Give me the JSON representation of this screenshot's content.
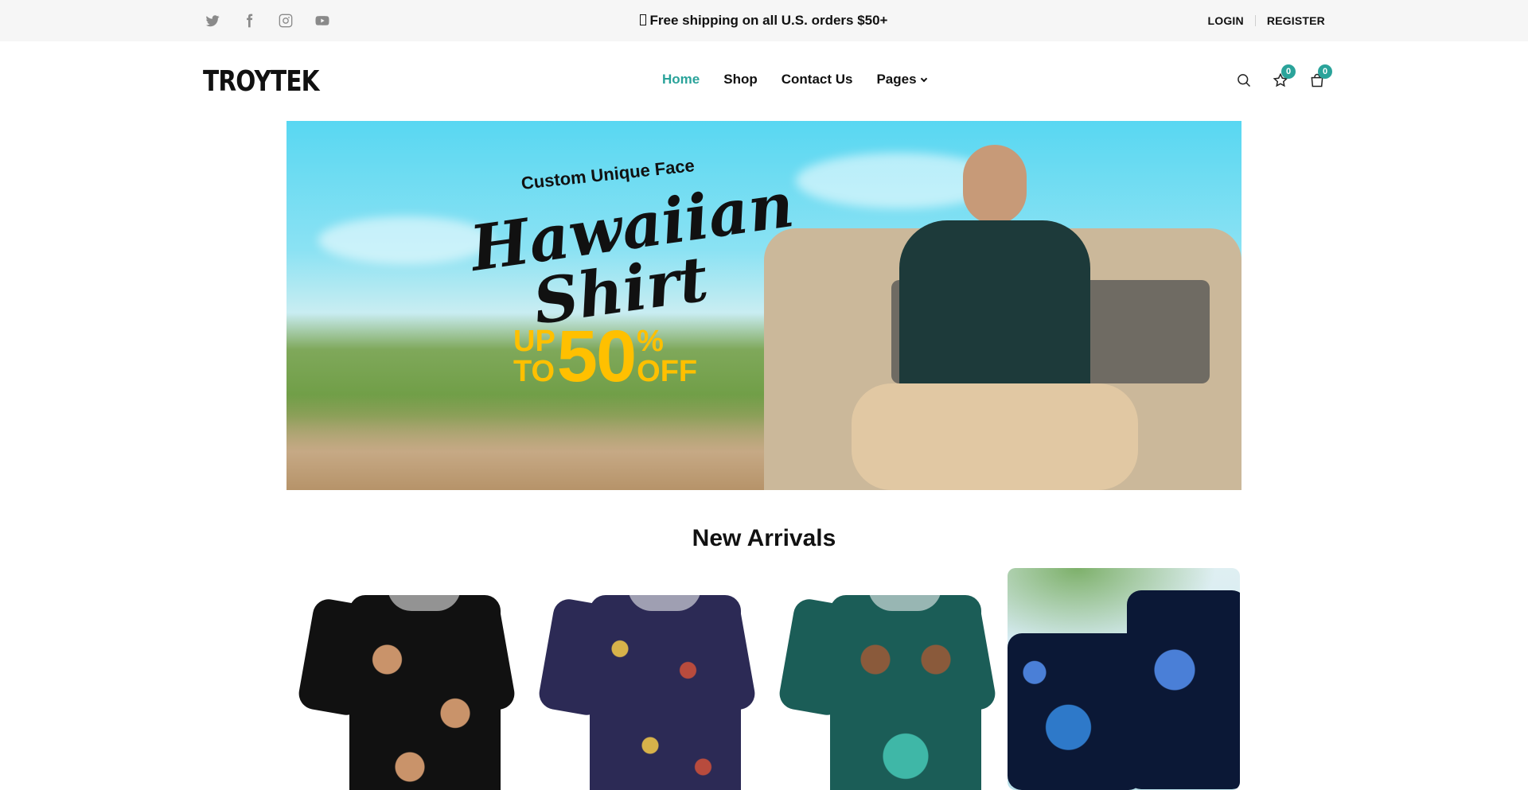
{
  "colors": {
    "accent": "#2aa39a",
    "topbar_bg": "#f6f6f6",
    "promo_yellow": "#ffc000"
  },
  "topbar": {
    "social": [
      {
        "name": "twitter-icon"
      },
      {
        "name": "facebook-icon"
      },
      {
        "name": "instagram-icon"
      },
      {
        "name": "youtube-icon"
      }
    ],
    "promo": "Free shipping on all U.S. orders $50+",
    "login": "LOGIN",
    "register": "REGISTER"
  },
  "header": {
    "logo": "TROYTEK",
    "nav": [
      {
        "label": "Home",
        "active": true
      },
      {
        "label": "Shop",
        "active": false
      },
      {
        "label": "Contact Us",
        "active": false
      },
      {
        "label": "Pages",
        "active": false,
        "has_dropdown": true
      }
    ],
    "wishlist_count": "0",
    "cart_count": "0"
  },
  "hero": {
    "line1": "Custom Unique Face",
    "line2": "Hawaiian",
    "line3": "Shirt",
    "up": "UP",
    "to": "TO",
    "percent_value": "50",
    "percent_sign": "%",
    "off": "OFF"
  },
  "new_arrivals": {
    "title": "New Arrivals",
    "products": [
      {
        "name": "product-card-1",
        "palette": [
          "#111111",
          "#c9936a"
        ]
      },
      {
        "name": "product-card-2",
        "palette": [
          "#2c2a55",
          "#c9813f"
        ]
      },
      {
        "name": "product-card-3",
        "palette": [
          "#1b5d57",
          "#3fb7a7"
        ]
      },
      {
        "name": "product-card-4",
        "palette": [
          "#0b1836",
          "#4a7fd7"
        ]
      }
    ]
  }
}
